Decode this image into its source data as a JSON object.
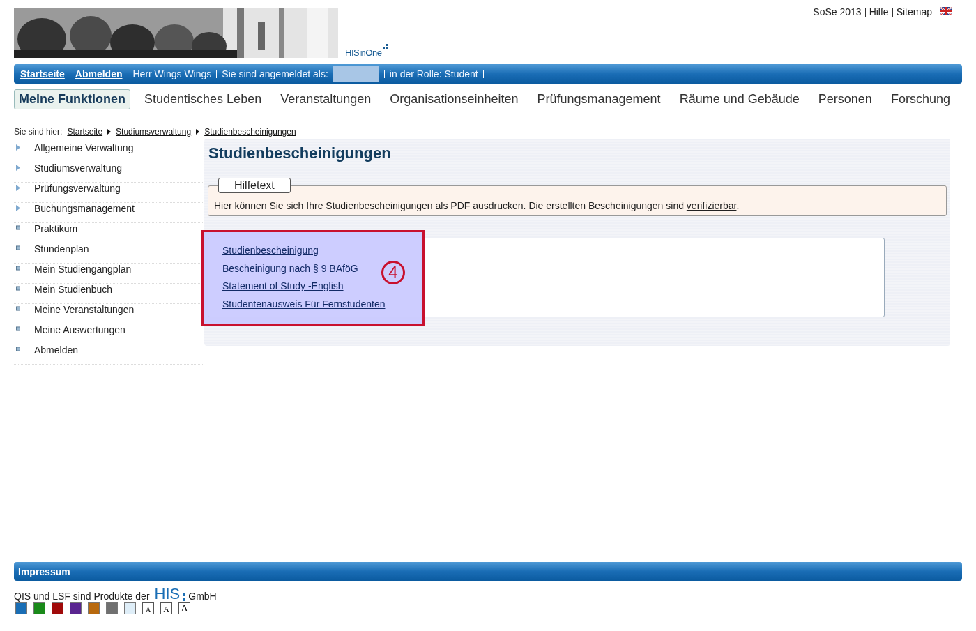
{
  "header": {
    "logo_text": "HISinOne",
    "top_links": [
      "SoSe 2013",
      "Hilfe",
      "Sitemap"
    ]
  },
  "user_bar": {
    "links": [
      "Startseite",
      "Abmelden"
    ],
    "user": "Herr Wings Wings",
    "login_label": "Sie sind angemeldet als:",
    "role": "in der Rolle: Student"
  },
  "main_nav": [
    {
      "label": "Meine Funktionen",
      "selected": true
    },
    {
      "label": "Studentisches Leben",
      "selected": false
    },
    {
      "label": "Veranstaltungen",
      "selected": false
    },
    {
      "label": "Organisationseinheiten",
      "selected": false
    },
    {
      "label": "Prüfungsmanagement",
      "selected": false
    },
    {
      "label": "Räume und Gebäude",
      "selected": false
    },
    {
      "label": "Personen",
      "selected": false
    },
    {
      "label": "Forschung",
      "selected": false
    }
  ],
  "breadcrumb": {
    "label": "Sie sind hier:",
    "items": [
      "Startseite",
      "Studiumsverwaltung",
      "Studienbescheinigungen"
    ]
  },
  "sidebar": {
    "items": [
      {
        "label": "Allgemeine Verwaltung",
        "kind": "folder"
      },
      {
        "label": "Studiumsverwaltung",
        "kind": "folder"
      },
      {
        "label": "Prüfungsverwaltung",
        "kind": "folder"
      },
      {
        "label": "Buchungsmanagement",
        "kind": "folder"
      },
      {
        "label": "Praktikum",
        "kind": "leaf"
      },
      {
        "label": "Stundenplan",
        "kind": "leaf"
      },
      {
        "label": "Mein Studiengangplan",
        "kind": "leaf"
      },
      {
        "label": "Mein Studienbuch",
        "kind": "leaf"
      },
      {
        "label": "Meine Veranstaltungen",
        "kind": "leaf"
      },
      {
        "label": "Meine Auswertungen",
        "kind": "leaf"
      },
      {
        "label": "Abmelden",
        "kind": "leaf"
      }
    ]
  },
  "content": {
    "title": "Studienbescheinigungen",
    "help": {
      "legend": "Hilfetext",
      "text": "Hier können Sie sich Ihre Studienbescheinigungen als PDF ausdrucken. Die erstellten Bescheinigungen sind",
      "link": "verifizierbar",
      "end": "."
    },
    "links": [
      "Studienbescheinigung",
      "Bescheinigung nach § 9 BAföG",
      "Statement of Study -English",
      "Studentenausweis Für Fernstudenten"
    ],
    "annotation": {
      "number": "4"
    }
  },
  "footer": {
    "bar_link": "Impressum",
    "text": "QIS und LSF sind Produkte der",
    "logo": "HIS",
    "company": "GmbH",
    "themes": [
      {
        "color": "#1a6eb5"
      },
      {
        "color": "#1a8a1a"
      },
      {
        "color": "#a00a0a"
      },
      {
        "color": "#5a2590"
      },
      {
        "color": "#b8690e"
      },
      {
        "color": "#707070"
      },
      {
        "color": "#dfeef8"
      }
    ],
    "font_sizes": [
      "A",
      "A",
      "A"
    ]
  }
}
